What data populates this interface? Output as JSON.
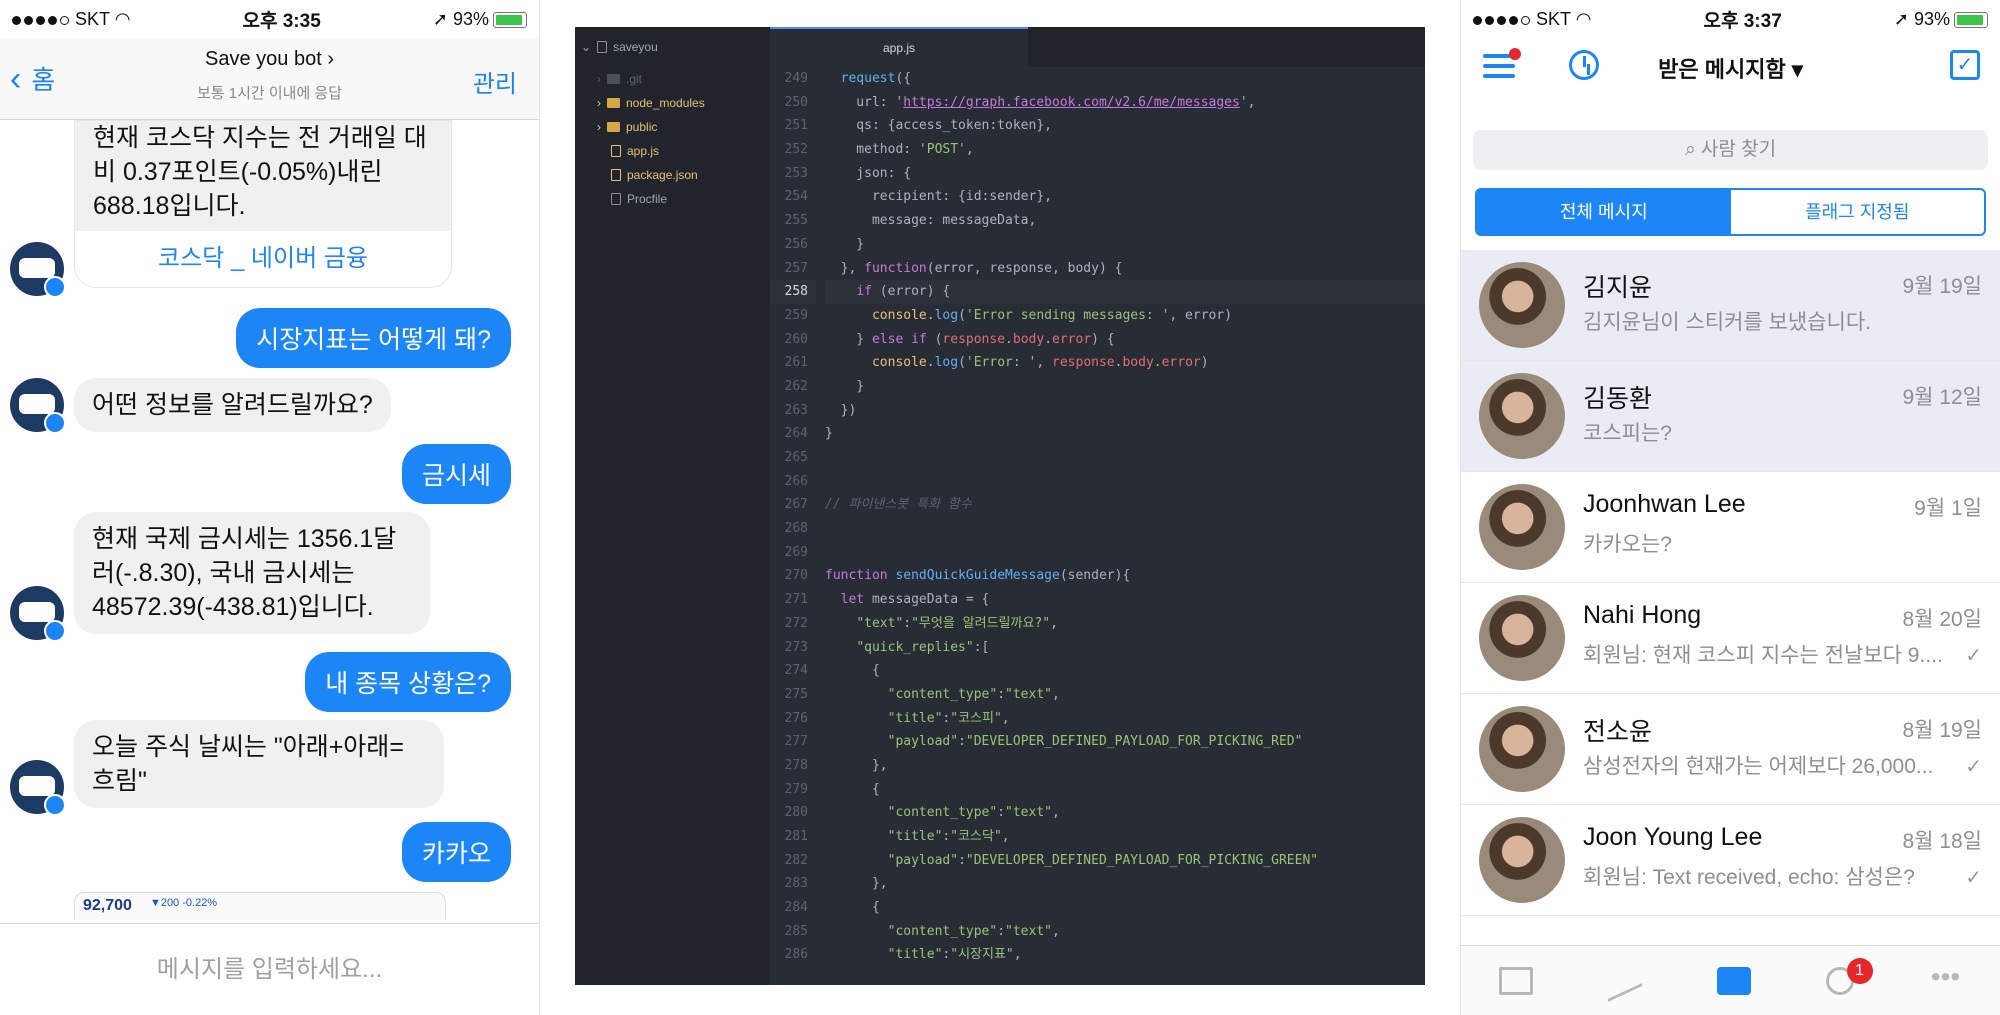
{
  "left_phone": {
    "status": {
      "carrier": "SKT",
      "time": "오후 3:35",
      "battery": "93%"
    },
    "header": {
      "back_label": "홈",
      "title": "Save you bot",
      "subtitle": "보통 1시간 이내에 응답",
      "manage_label": "관리"
    },
    "messages": {
      "card_text": "현재 코스닥 지수는 전 거래일 대비 0.37포인트(-0.05%)내린 688.18입니다.",
      "card_link": "코스닥 _ 네이버 금융",
      "out_1": "시장지표는 어떻게 돼?",
      "in_1": "어떤 정보를 알려드릴까요?",
      "out_2": "금시세",
      "in_2": "현재 국제 금시세는 1356.1달러(-.8.30), 국내 금시세는 48572.39(-438.81)입니다.",
      "out_3": "내 종목 상황은?",
      "in_3": "오늘 주식 날씨는 \"아래+아래=흐림\"",
      "out_4": "카카오",
      "thumb_price": "92,700",
      "thumb_change": "▼200 -0.22%"
    },
    "input_placeholder": "메시지를 입력하세요..."
  },
  "editor": {
    "tree": [
      {
        "label": "saveyou",
        "type": "root"
      },
      {
        "label": ".git",
        "type": "folder-muted"
      },
      {
        "label": "node_modules",
        "type": "folder"
      },
      {
        "label": "public",
        "type": "folder"
      },
      {
        "label": "app.js",
        "type": "file"
      },
      {
        "label": "package.json",
        "type": "file"
      },
      {
        "label": "Procfile",
        "type": "file-muted"
      }
    ],
    "tab": "app.js",
    "line_numbers": [
      "249",
      "250",
      "251",
      "252",
      "253",
      "254",
      "255",
      "256",
      "257",
      "258",
      "259",
      "260",
      "261",
      "262",
      "263",
      "264",
      "265",
      "266",
      "267",
      "268",
      "269",
      "270",
      "271",
      "272",
      "273",
      "274",
      "275",
      "276",
      "277",
      "278",
      "279",
      "280",
      "281",
      "282",
      "283",
      "284",
      "285",
      "286"
    ],
    "current_line": "258"
  },
  "right_phone": {
    "status": {
      "carrier": "SKT",
      "time": "오후 3:37",
      "battery": "93%"
    },
    "title": "받은 메시지함",
    "search_placeholder": "사람 찾기",
    "segments": [
      "전체 메시지",
      "플래그 지정됨"
    ],
    "conversations": [
      {
        "name": "김지윤",
        "date": "9월 19일",
        "preview": "김지윤님이 스티커를 보냈습니다."
      },
      {
        "name": "김동환",
        "date": "9월 12일",
        "preview": "코스피는?"
      },
      {
        "name": "Joonhwan Lee",
        "date": "9월 1일",
        "preview": "카카오는?"
      },
      {
        "name": "Nahi Hong",
        "date": "8월 20일",
        "preview": "회원님: 현재 코스피 지수는 전날보다 9...."
      },
      {
        "name": "전소윤",
        "date": "8월 19일",
        "preview": "삼성전자의 현재가는 어제보다 26,000..."
      },
      {
        "name": "Joon Young Lee",
        "date": "8월 18일",
        "preview": "회원님: Text received, echo: 삼성은?"
      }
    ],
    "tab_badge": "1",
    "colors": {
      "accent": "#1c86f7",
      "badge": "#e8272d"
    }
  }
}
